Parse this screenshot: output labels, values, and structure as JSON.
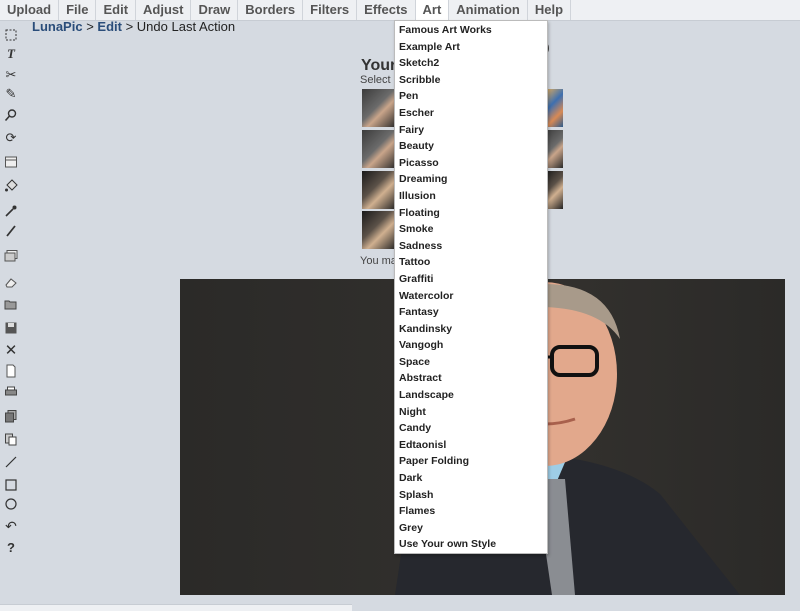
{
  "menubar": {
    "items": [
      "Upload",
      "File",
      "Edit",
      "Adjust",
      "Draw",
      "Borders",
      "Filters",
      "Effects",
      "Art",
      "Animation",
      "Help"
    ],
    "active": "Art"
  },
  "breadcrumb": {
    "root": "LunaPic",
    "section": "Edit",
    "current": "Undo Last Action",
    "sep1": " > ",
    "sep2": " > "
  },
  "main": {
    "title_fragment": "Your",
    "select_fragment": "Select",
    "paren_fragment": ")",
    "may_fragment": "You ma"
  },
  "art_menu": {
    "items": [
      "Famous Art Works",
      "Example Art",
      "Sketch2",
      "Scribble",
      "Pen",
      "Escher",
      "Fairy",
      "Beauty",
      "Picasso",
      "Dreaming",
      "Illusion",
      "Floating",
      "Smoke",
      "Sadness",
      "Tattoo",
      "Graffiti",
      "Watercolor",
      "Fantasy",
      "Kandinsky",
      "Vangogh",
      "Space",
      "Abstract",
      "Landscape",
      "Night",
      "Candy",
      "Edtaonisl",
      "Paper Folding",
      "Dark",
      "Splash",
      "Flames",
      "Grey",
      "Use Your own Style"
    ]
  },
  "toolbar": {
    "icons": [
      "marquee-select",
      "text",
      "scissors",
      "pencil",
      "zoom",
      "rotate",
      "layer",
      "paint-bucket",
      "eyedropper",
      "brush",
      "images",
      "eraser",
      "open",
      "save",
      "close",
      "new",
      "print",
      "copy",
      "paste",
      "line",
      "rectangle",
      "circle",
      "undo",
      "help"
    ]
  },
  "colors": {
    "menubar_bg": "#eef0f3",
    "page_bg": "#d5dae1",
    "link": "#2a4d7a"
  }
}
